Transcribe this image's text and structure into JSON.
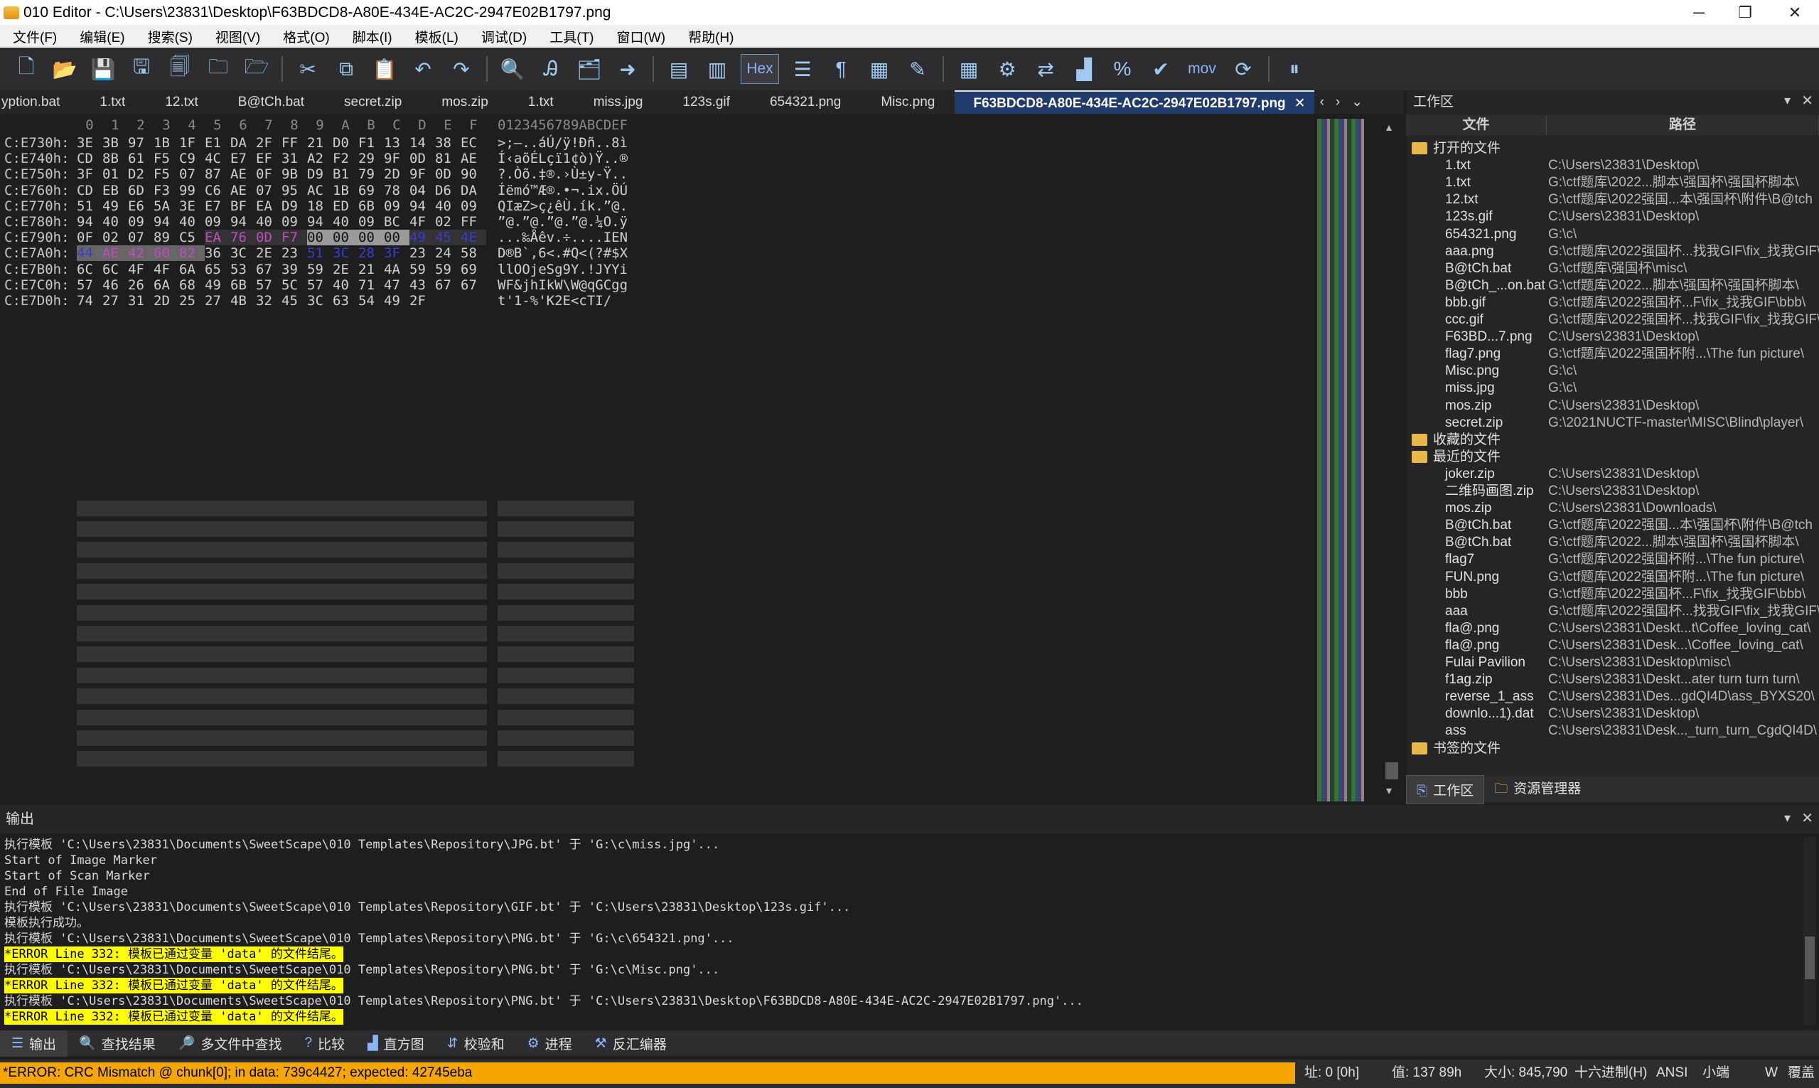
{
  "window": {
    "title": "010 Editor - C:\\Users\\23831\\Desktop\\F63BDCD8-A80E-434E-AC2C-2947E02B1797.png",
    "minimize": "─",
    "maximize": "❐",
    "close": "✕"
  },
  "menu": [
    "文件(F)",
    "编辑(E)",
    "搜索(S)",
    "视图(V)",
    "格式(O)",
    "脚本(I)",
    "模板(L)",
    "调试(D)",
    "工具(T)",
    "窗口(W)",
    "帮助(H)"
  ],
  "toolbar": {
    "hex_label": "Hex",
    "mov_label": "mov"
  },
  "tabs": [
    "yption.bat",
    "1.txt",
    "12.txt",
    "B@tCh.bat",
    "secret.zip",
    "mos.zip",
    "1.txt",
    "miss.jpg",
    "123s.gif",
    "654321.png",
    "Misc.png"
  ],
  "active_tab": "F63BDCD8-A80E-434E-AC2C-2947E02B1797.png",
  "hex": {
    "col_header": [
      "0",
      "1",
      "2",
      "3",
      "4",
      "5",
      "6",
      "7",
      "8",
      "9",
      "A",
      "B",
      "C",
      "D",
      "E",
      "F"
    ],
    "ascii_header": "0123456789ABCDEF",
    "rows": [
      {
        "addr": "C:E730h:",
        "bytes": [
          "3E",
          "3B",
          "97",
          "1B",
          "1F",
          "E1",
          "DA",
          "2F",
          "FF",
          "21",
          "D0",
          "F1",
          "13",
          "14",
          "38",
          "EC"
        ],
        "ascii": ">;—..áÚ/ÿ!Ðñ..8ì"
      },
      {
        "addr": "C:E740h:",
        "bytes": [
          "CD",
          "8B",
          "61",
          "F5",
          "C9",
          "4C",
          "E7",
          "EF",
          "31",
          "A2",
          "F2",
          "29",
          "9F",
          "0D",
          "81",
          "AE"
        ],
        "ascii": "Í‹aõÉLçï1¢ò)Ÿ..®"
      },
      {
        "addr": "C:E750h:",
        "bytes": [
          "3F",
          "01",
          "D2",
          "F5",
          "07",
          "87",
          "AE",
          "0F",
          "9B",
          "D9",
          "B1",
          "79",
          "2D",
          "9F",
          "0D",
          "90"
        ],
        "ascii": "?.Òõ.‡®.›Ù±y-Ÿ.."
      },
      {
        "addr": "C:E760h:",
        "bytes": [
          "CD",
          "EB",
          "6D",
          "F3",
          "99",
          "C6",
          "AE",
          "07",
          "95",
          "AC",
          "1B",
          "69",
          "78",
          "04",
          "D6",
          "DA"
        ],
        "ascii": "Íëmó™Æ®.•¬.ix.ÖÚ"
      },
      {
        "addr": "C:E770h:",
        "bytes": [
          "51",
          "49",
          "E6",
          "5A",
          "3E",
          "E7",
          "BF",
          "EA",
          "D9",
          "18",
          "ED",
          "6B",
          "09",
          "94",
          "40",
          "09"
        ],
        "ascii": "QIæZ>ç¿êÙ.ík.”@."
      },
      {
        "addr": "C:E780h:",
        "bytes": [
          "94",
          "40",
          "09",
          "94",
          "40",
          "09",
          "94",
          "40",
          "09",
          "94",
          "40",
          "09",
          "BC",
          "4F",
          "02",
          "FF"
        ],
        "ascii": "”@.”@.”@.”@.¼O.ÿ"
      },
      {
        "addr": "C:E790h:",
        "bytes": [
          "0F",
          "02",
          "07",
          "89",
          "C5",
          "EA",
          "76",
          "0D",
          "F7",
          "00",
          "00",
          "00",
          "00",
          "49",
          "45",
          "4E"
        ],
        "ascii": "...‰Åêv.÷....IEN"
      },
      {
        "addr": "C:E7A0h:",
        "bytes": [
          "44",
          "AE",
          "42",
          "60",
          "82",
          "36",
          "3C",
          "2E",
          "23",
          "51",
          "3C",
          "28",
          "3F",
          "23",
          "24",
          "58"
        ],
        "ascii": "D®B`‚6<.#Q<(?#$X"
      },
      {
        "addr": "C:E7B0h:",
        "bytes": [
          "6C",
          "6C",
          "4F",
          "4F",
          "6A",
          "65",
          "53",
          "67",
          "39",
          "59",
          "2E",
          "21",
          "4A",
          "59",
          "59",
          "69"
        ],
        "ascii": "llOOjeSg9Y.!JYYi"
      },
      {
        "addr": "C:E7C0h:",
        "bytes": [
          "57",
          "46",
          "26",
          "6A",
          "68",
          "49",
          "6B",
          "57",
          "5C",
          "57",
          "40",
          "71",
          "47",
          "43",
          "67",
          "67"
        ],
        "ascii": "WF&jhIkW\\W@qGCgg"
      },
      {
        "addr": "C:E7D0h:",
        "bytes": [
          "74",
          "27",
          "31",
          "2D",
          "25",
          "27",
          "4B",
          "32",
          "45",
          "3C",
          "63",
          "54",
          "49",
          "2F"
        ],
        "ascii": "t'1-%'K2E<cTI/"
      }
    ]
  },
  "colors": {
    "chunk_crc": "#c04cc0",
    "iend_len": "#9a9a9a",
    "iend_type": "#3b3bd0",
    "accent_tab": "#1f3a6b",
    "error_bar": "#f5a600"
  },
  "workspace": {
    "title": "工作区",
    "col_file": "文件",
    "col_path": "路径",
    "group_open": "打开的文件",
    "open_files": [
      {
        "name": "1.txt",
        "path": "C:\\Users\\23831\\Desktop\\"
      },
      {
        "name": "1.txt",
        "path": "G:\\ctf题库\\2022...脚本\\强国杯\\强国杯脚本\\"
      },
      {
        "name": "12.txt",
        "path": "G:\\ctf题库\\2022强国...本\\强国杯\\附件\\B@tch"
      },
      {
        "name": "123s.gif",
        "path": "C:\\Users\\23831\\Desktop\\"
      },
      {
        "name": "654321.png",
        "path": "G:\\c\\"
      },
      {
        "name": "aaa.png",
        "path": "G:\\ctf题库\\2022强国杯...找我GIF\\fix_找我GIF\\"
      },
      {
        "name": "B@tCh.bat",
        "path": "G:\\ctf题库\\强国杯\\misc\\"
      },
      {
        "name": "B@tCh_...on.bat",
        "path": "G:\\ctf题库\\2022...脚本\\强国杯\\强国杯脚本\\"
      },
      {
        "name": "bbb.gif",
        "path": "G:\\ctf题库\\2022强国杯...F\\fix_找我GIF\\bbb\\"
      },
      {
        "name": "ccc.gif",
        "path": "G:\\ctf题库\\2022强国杯...找我GIF\\fix_找我GIF\\"
      },
      {
        "name": "F63BD...7.png",
        "path": "C:\\Users\\23831\\Desktop\\"
      },
      {
        "name": "flag7.png",
        "path": "G:\\ctf题库\\2022强国杯附...\\The fun picture\\"
      },
      {
        "name": "Misc.png",
        "path": "G:\\c\\"
      },
      {
        "name": "miss.jpg",
        "path": "G:\\c\\"
      },
      {
        "name": "mos.zip",
        "path": "C:\\Users\\23831\\Desktop\\"
      },
      {
        "name": "secret.zip",
        "path": "G:\\2021NUCTF-master\\MISC\\Blind\\player\\"
      }
    ],
    "group_fav": "收藏的文件",
    "group_recent": "最近的文件",
    "recent_files": [
      {
        "name": "joker.zip",
        "path": "C:\\Users\\23831\\Desktop\\"
      },
      {
        "name": "二维码画图.zip",
        "path": "C:\\Users\\23831\\Desktop\\"
      },
      {
        "name": "mos.zip",
        "path": "C:\\Users\\23831\\Downloads\\"
      },
      {
        "name": "B@tCh.bat",
        "path": "G:\\ctf题库\\2022强国...本\\强国杯\\附件\\B@tch"
      },
      {
        "name": "B@tCh.bat",
        "path": "G:\\ctf题库\\2022...脚本\\强国杯\\强国杯脚本\\"
      },
      {
        "name": "flag7",
        "path": "G:\\ctf题库\\2022强国杯附...\\The fun picture\\"
      },
      {
        "name": "FUN.png",
        "path": "G:\\ctf题库\\2022强国杯附...\\The fun picture\\"
      },
      {
        "name": "bbb",
        "path": "G:\\ctf题库\\2022强国杯...F\\fix_找我GIF\\bbb\\"
      },
      {
        "name": "aaa",
        "path": "G:\\ctf题库\\2022强国杯...找我GIF\\fix_找我GIF\\"
      },
      {
        "name": "fla@.png",
        "path": "C:\\Users\\23831\\Deskt...t\\Coffee_loving_cat\\"
      },
      {
        "name": "fla@.png",
        "path": "C:\\Users\\23831\\Desk...\\Coffee_loving_cat\\"
      },
      {
        "name": "Fulai Pavilion",
        "path": "C:\\Users\\23831\\Desktop\\misc\\"
      },
      {
        "name": "f1ag.zip",
        "path": "C:\\Users\\23831\\Deskt...ater turn turn turn\\"
      },
      {
        "name": "reverse_1_ass",
        "path": "C:\\Users\\23831\\Des...gdQI4D\\ass_BYXS20\\"
      },
      {
        "name": "downlo...1).dat",
        "path": "C:\\Users\\23831\\Desktop\\"
      },
      {
        "name": "ass",
        "path": "C:\\Users\\23831\\Desk..._turn_turn_CgdQI4D\\"
      }
    ],
    "group_bookmark": "书签的文件",
    "tab_workspace": "工作区",
    "tab_explorer": "资源管理器"
  },
  "output": {
    "title": "输出",
    "lines": [
      {
        "text": "执行模板 'C:\\Users\\23831\\Documents\\SweetScape\\010 Templates\\Repository\\JPG.bt' 于 'G:\\c\\miss.jpg'...",
        "err": false
      },
      {
        "text": "Start of Image Marker",
        "err": false
      },
      {
        "text": "Start of Scan Marker",
        "err": false
      },
      {
        "text": "End of File Image",
        "err": false
      },
      {
        "text": "执行模板 'C:\\Users\\23831\\Documents\\SweetScape\\010 Templates\\Repository\\GIF.bt' 于 'C:\\Users\\23831\\Desktop\\123s.gif'...",
        "err": false
      },
      {
        "text": "模板执行成功。",
        "err": false
      },
      {
        "text": "执行模板 'C:\\Users\\23831\\Documents\\SweetScape\\010 Templates\\Repository\\PNG.bt' 于 'G:\\c\\654321.png'...",
        "err": false
      },
      {
        "text": "*ERROR Line 332: 模板已通过变量 'data' 的文件结尾。",
        "err": true
      },
      {
        "text": "执行模板 'C:\\Users\\23831\\Documents\\SweetScape\\010 Templates\\Repository\\PNG.bt' 于 'G:\\c\\Misc.png'...",
        "err": false
      },
      {
        "text": "*ERROR Line 332: 模板已通过变量 'data' 的文件结尾。",
        "err": true
      },
      {
        "text": "执行模板 'C:\\Users\\23831\\Documents\\SweetScape\\010 Templates\\Repository\\PNG.bt' 于 'C:\\Users\\23831\\Desktop\\F63BDCD8-A80E-434E-AC2C-2947E02B1797.png'...",
        "err": false
      },
      {
        "text": "*ERROR Line 332: 模板已通过变量 'data' 的文件结尾。",
        "err": true
      }
    ]
  },
  "output_tabs": [
    "输出",
    "查找结果",
    "多文件中查找",
    "比较",
    "直方图",
    "校验和",
    "进程",
    "反汇编器"
  ],
  "status": {
    "error": "*ERROR: CRC Mismatch @ chunk[0]; in data: 739c4427; expected: 42745eba",
    "addr": "址: 0 [0h]",
    "value": "值: 137 89h",
    "size": "大小: 845,790",
    "mode": "十六进制(H)",
    "charset": "ANSI",
    "endian": "小端",
    "w": "W",
    "overwrite": "覆盖"
  }
}
